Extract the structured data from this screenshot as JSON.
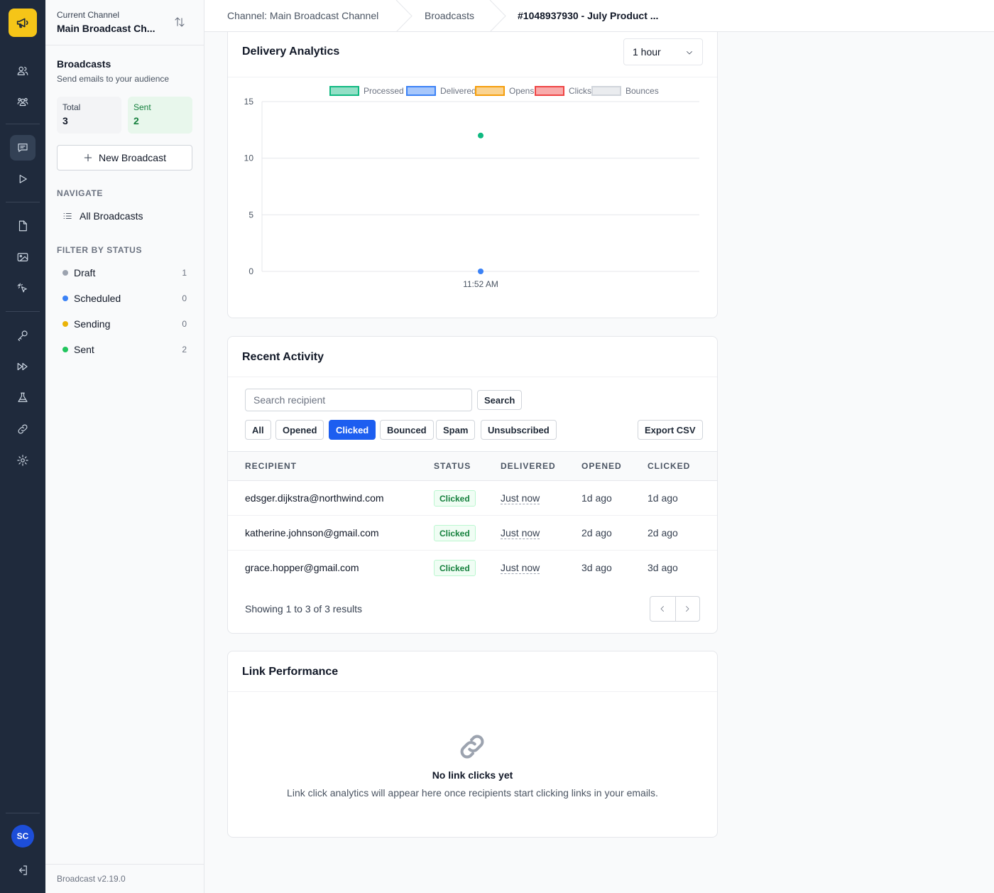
{
  "rail": {
    "items": [
      "users-icon",
      "audience-icon",
      "broadcast-icon",
      "play-icon",
      "document-icon",
      "image-icon",
      "pointer-icon",
      "key-icon",
      "forward-icon",
      "flask-icon",
      "link-icon",
      "gear-icon"
    ],
    "avatar_initials": "SC"
  },
  "sidebar": {
    "channel_label": "Current Channel",
    "channel_value": "Main Broadcast Ch...",
    "title": "Broadcasts",
    "subtitle": "Send emails to your audience",
    "stats": {
      "total_label": "Total",
      "total_value": "3",
      "sent_label": "Sent",
      "sent_value": "2"
    },
    "new_button": "New Broadcast",
    "navigate_heading": "NAVIGATE",
    "nav_all": "All Broadcasts",
    "filter_heading": "FILTER BY STATUS",
    "filters": [
      {
        "label": "Draft",
        "count": "1",
        "color": "#9ca3af"
      },
      {
        "label": "Scheduled",
        "count": "0",
        "color": "#3b82f6"
      },
      {
        "label": "Sending",
        "count": "0",
        "color": "#eab308"
      },
      {
        "label": "Sent",
        "count": "2",
        "color": "#22c55e"
      }
    ],
    "version": "Broadcast v2.19.0"
  },
  "breadcrumb": {
    "channel": "Channel: Main Broadcast Channel",
    "broadcasts": "Broadcasts",
    "current": "#1048937930 - July Product ..."
  },
  "analytics": {
    "title": "Delivery Analytics",
    "range": "1 hour"
  },
  "chart_data": {
    "type": "scatter",
    "x": [
      "11:52 AM"
    ],
    "series": [
      {
        "name": "Processed",
        "values": [
          12
        ],
        "color": "#10b981"
      },
      {
        "name": "Delivered",
        "values": [
          0
        ],
        "color": "#3b82f6"
      },
      {
        "name": "Opens",
        "values": [
          null
        ],
        "color": "#f59e0b"
      },
      {
        "name": "Clicks",
        "values": [
          null
        ],
        "color": "#ef4444"
      },
      {
        "name": "Bounces",
        "values": [
          null
        ],
        "color": "#d1d5db"
      }
    ],
    "yticks": [
      0,
      5,
      10,
      15
    ],
    "ylim": [
      0,
      15
    ],
    "grid": true,
    "legend": "top"
  },
  "activity": {
    "title": "Recent Activity",
    "search_placeholder": "Search recipient",
    "search_button": "Search",
    "filters": [
      "All",
      "Opened",
      "Clicked",
      "Bounced",
      "Spam",
      "Unsubscribed"
    ],
    "export_button": "Export CSV",
    "columns": [
      "RECIPIENT",
      "STATUS",
      "DELIVERED",
      "OPENED",
      "CLICKED"
    ],
    "rows": [
      {
        "recipient": "edsger.dijkstra@northwind.com",
        "status": "Clicked",
        "delivered": "Just now",
        "opened": "1d ago",
        "clicked": "1d ago"
      },
      {
        "recipient": "katherine.johnson@gmail.com",
        "status": "Clicked",
        "delivered": "Just now",
        "opened": "2d ago",
        "clicked": "2d ago"
      },
      {
        "recipient": "grace.hopper@gmail.com",
        "status": "Clicked",
        "delivered": "Just now",
        "opened": "3d ago",
        "clicked": "3d ago"
      }
    ],
    "showing": "Showing 1 to 3 of 3 results"
  },
  "links": {
    "title": "Link Performance",
    "empty_title": "No link clicks yet",
    "empty_sub": "Link click analytics will appear here once recipients start clicking links in your emails."
  }
}
